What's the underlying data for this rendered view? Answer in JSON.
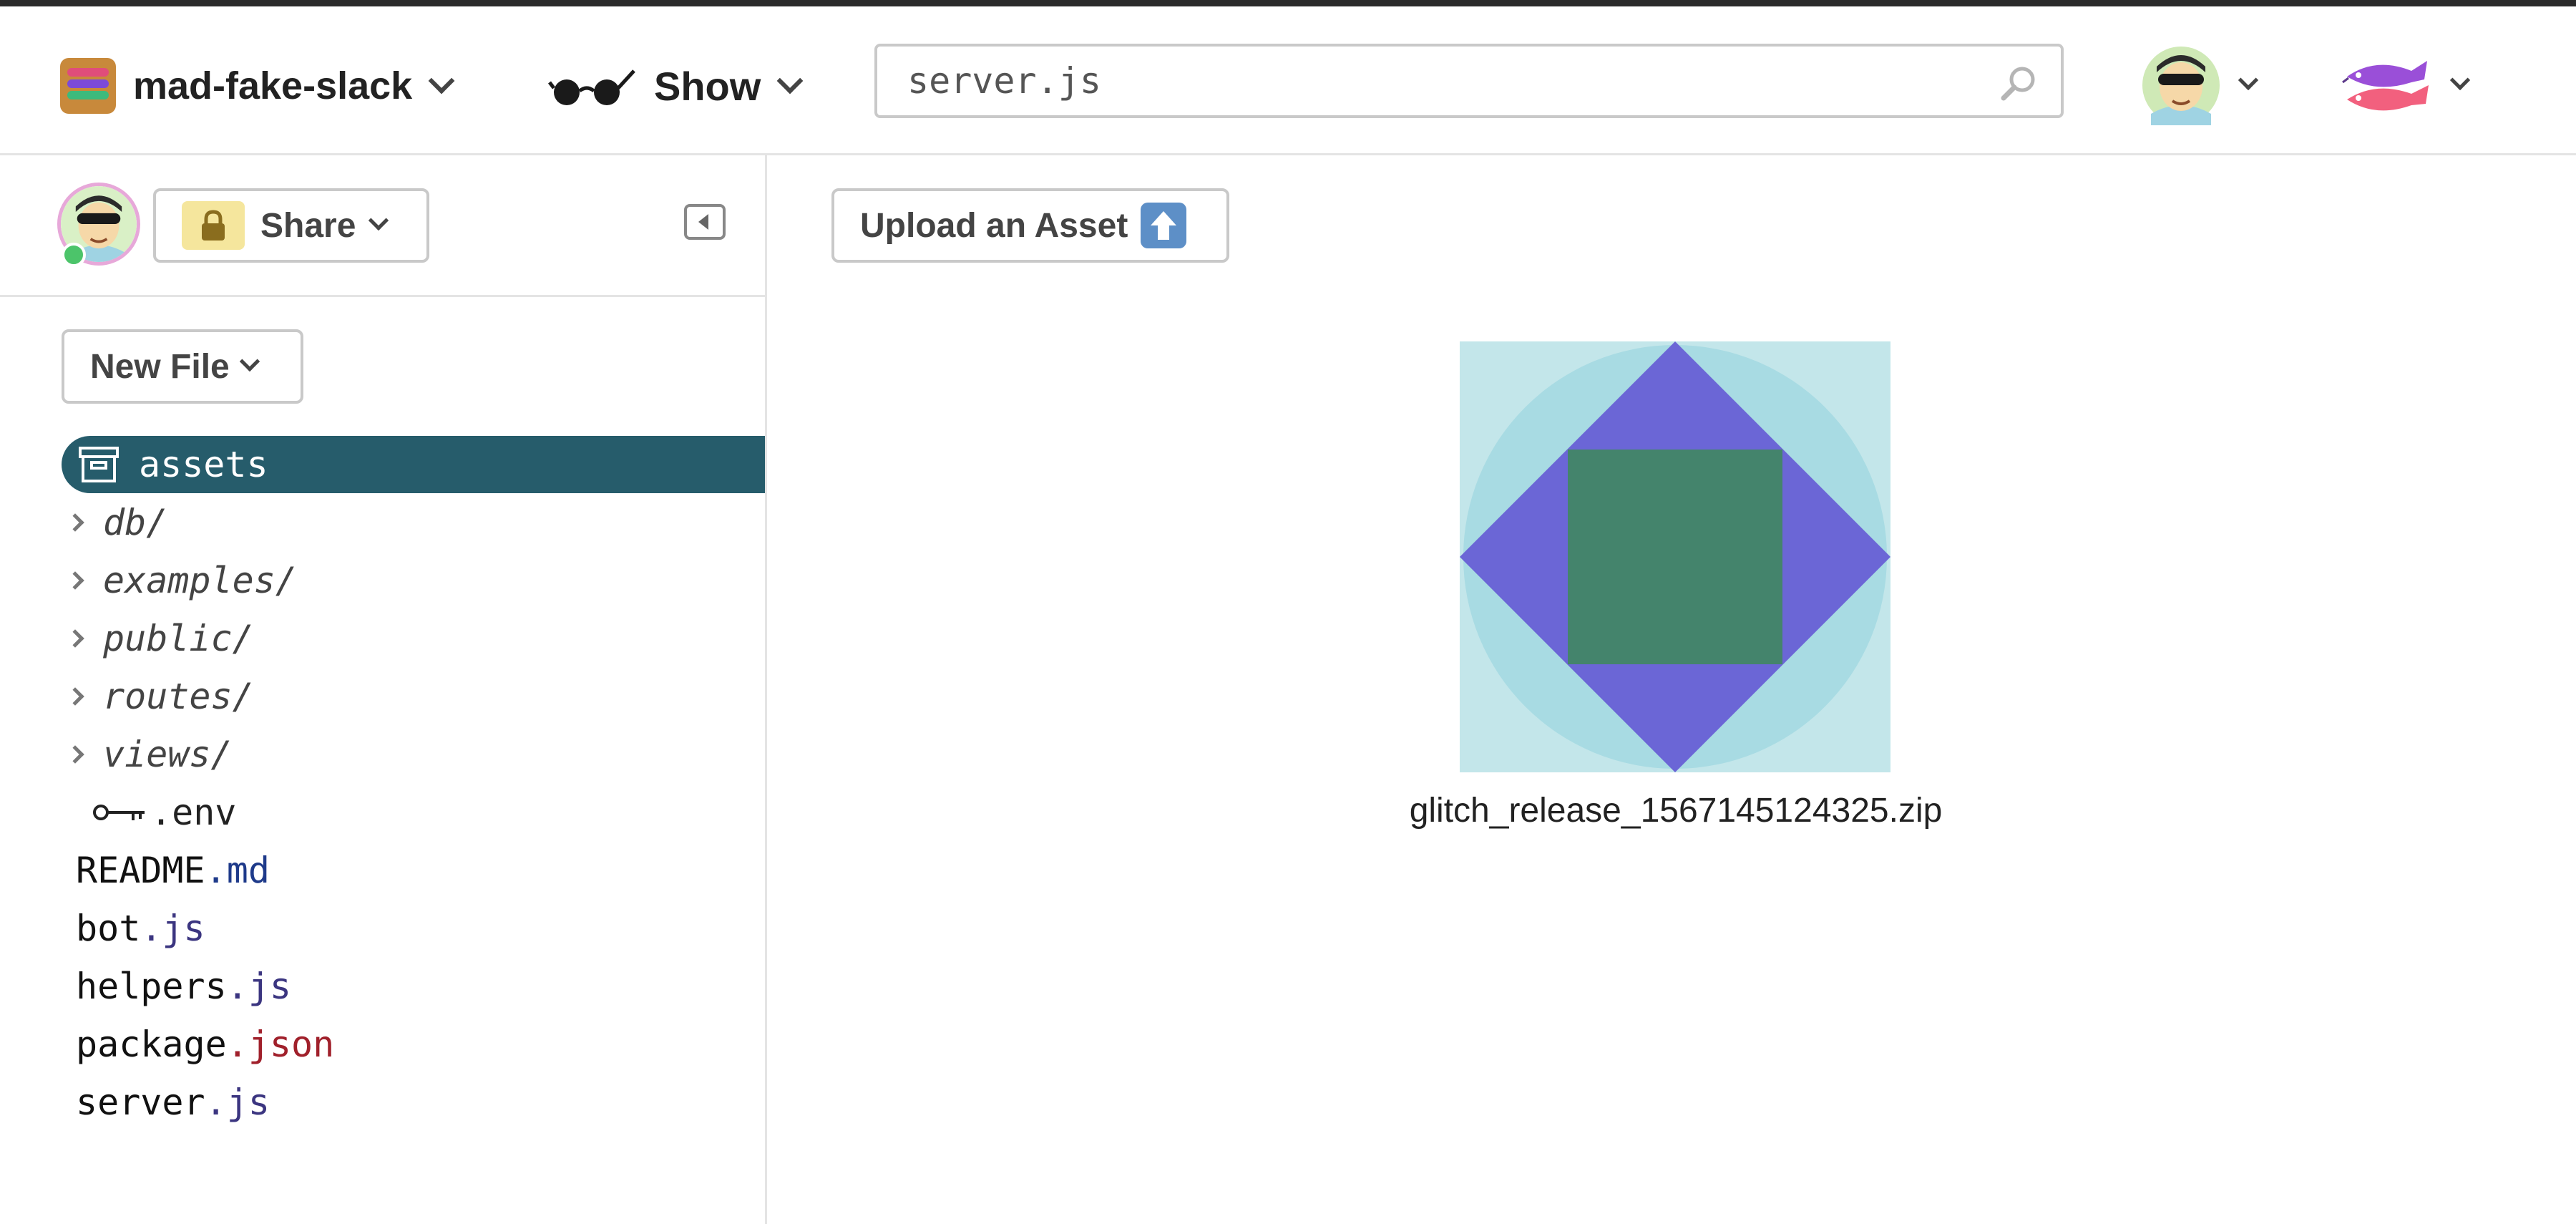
{
  "header": {
    "project_name": "mad-fake-slack",
    "show_label": "Show",
    "search": {
      "value": "server.js",
      "placeholder": ""
    }
  },
  "sidebar": {
    "share_label": "Share",
    "new_file_label": "New File",
    "tree": {
      "assets": "assets",
      "folders": [
        "db/",
        "examples/",
        "public/",
        "routes/",
        "views/"
      ],
      "env_file": ".env",
      "files": [
        {
          "base": "README",
          "ext": ".md"
        },
        {
          "base": "bot",
          "ext": ".js"
        },
        {
          "base": "helpers",
          "ext": ".js"
        },
        {
          "base": "package",
          "ext": ".json"
        },
        {
          "base": "server",
          "ext": ".js"
        }
      ]
    }
  },
  "main": {
    "upload_label": "Upload an Asset",
    "asset": {
      "filename": "glitch_release_1567145124325.zip"
    }
  },
  "colors": {
    "accent_selected": "#265c6b",
    "thumb_bg": "#c3e6ea",
    "thumb_circle": "#a8dbe3",
    "thumb_diamond": "#6b66d6",
    "thumb_square": "#44846c"
  }
}
